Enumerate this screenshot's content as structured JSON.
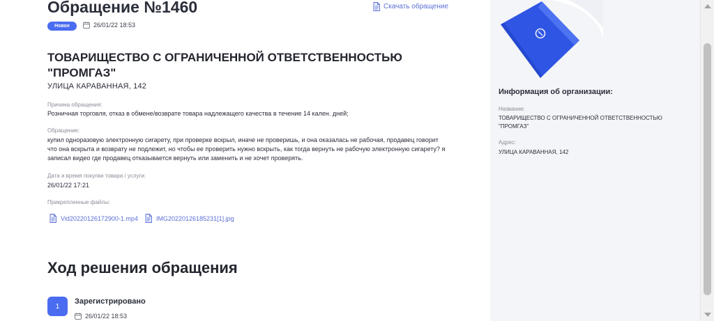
{
  "request": {
    "title": "Обращение №1460",
    "download_label": "Скачать обращение",
    "status_badge": "Новое",
    "created_at": "26/01/22 18:53"
  },
  "organization": {
    "name": "ТОВАРИЩЕСТВО С ОГРАНИЧЕННОЙ ОТВЕТСТВЕННОСТЬЮ \"ПРОМГАЗ\"",
    "address": "УЛИЦА КАРАВАННАЯ, 142"
  },
  "fields": {
    "reason_label": "Причина обращения:",
    "reason_value": "Розничная торговля, отказ в обмене/возврате товара надлежащего качества в течение 14 кален. дней;",
    "text_label": "Обращение:",
    "text_value": "купил одноразовую электронную сигарету, при проверке вскрыл, иначе не проверишь, и она оказалась не рабочая, продавец говорит что она вскрыта и возврату не подлежит, но чтобы ее проверить нужно вскрыть, как тогда вернуть не рабочую электронную сигарету? я записал видео где продавец отказывается вернуть или заменить и не хочет проверять.",
    "purchase_label": "Дата и время покупки товара / услуги:",
    "purchase_value": "26/01/22 17:21",
    "attachments_label": "Прикрепленные файлы:",
    "attachments": [
      "Vid20220126172900-1.mp4",
      "IMG20220126185231[1].jpg"
    ]
  },
  "progress": {
    "title": "Ход решения обращения",
    "steps": [
      {
        "number": "1",
        "label": "Зарегистрировано",
        "date": "26/01/22 18:53"
      }
    ]
  },
  "sidebar": {
    "info_title": "Информация об организации:",
    "name_label": "Название:",
    "name_value": "ТОВАРИЩЕСТВО С ОГРАНИЧЕННОЙ ОТВЕТСТВЕННОСТЬЮ \"ПРОМГАЗ\"",
    "address_label": "Адрес:",
    "address_value": "УЛИЦА КАРАВАННАЯ, 142"
  },
  "icons": {
    "document": "document-icon",
    "calendar": "calendar-icon",
    "file": "file-icon"
  },
  "colors": {
    "accent": "#4a6cf0",
    "link": "#5a6fd6",
    "sidebar_bg": "#f4f5f8"
  }
}
